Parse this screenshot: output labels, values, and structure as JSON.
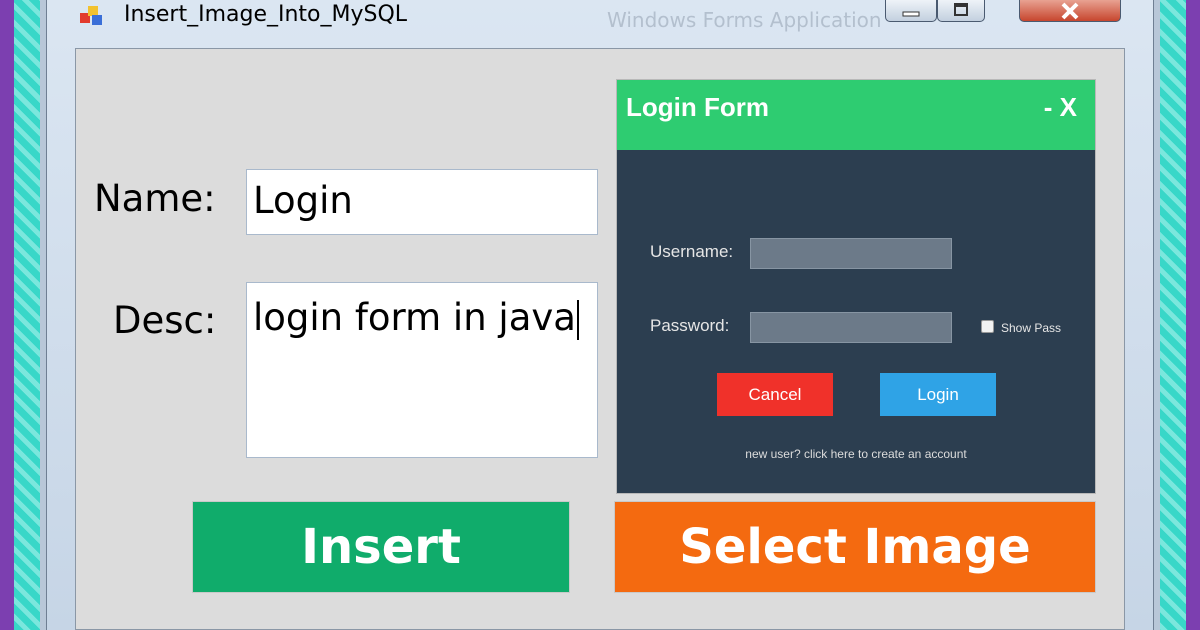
{
  "window": {
    "title": "Insert_Image_Into_MySQL",
    "background_title": "Windows Forms Application",
    "controls": {
      "minimize_icon": "minimize-icon",
      "maximize_icon": "maximize-icon",
      "close_label": "X"
    }
  },
  "form": {
    "name_label": "Name:",
    "name_value": "Login",
    "desc_label": "Desc:",
    "desc_value": "login form in java",
    "insert_label": "Insert",
    "select_image_label": "Select Image"
  },
  "preview_image": {
    "title": "Login Form",
    "window_controls": "- X",
    "username_label": "Username:",
    "password_label": "Password:",
    "show_pass_label": "Show Pass",
    "cancel_label": "Cancel",
    "login_label": "Login",
    "new_user_text": "new user? click here to create an account"
  },
  "colors": {
    "insert_button": "#10ac6b",
    "select_image_button": "#f46a10",
    "login_form_header": "#2ecc71",
    "login_form_body": "#2c3e50",
    "cancel_button": "#f0312a",
    "login_button": "#2fa3e6"
  }
}
